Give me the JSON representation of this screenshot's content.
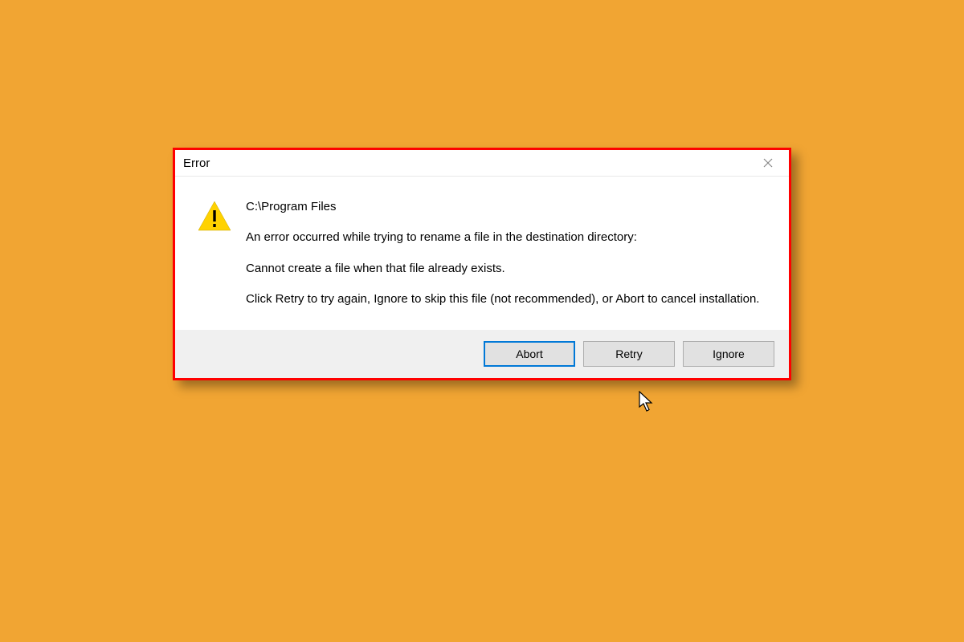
{
  "dialog": {
    "title": "Error",
    "path": "C:\\Program Files",
    "message_line1": "An error occurred while trying to rename a file in the destination directory:",
    "message_line2": "Cannot create a file when that file already exists.",
    "message_line3": "Click Retry to try again, Ignore to skip this file (not recommended), or Abort to cancel installation.",
    "buttons": {
      "abort": "Abort",
      "retry": "Retry",
      "ignore": "Ignore"
    }
  }
}
